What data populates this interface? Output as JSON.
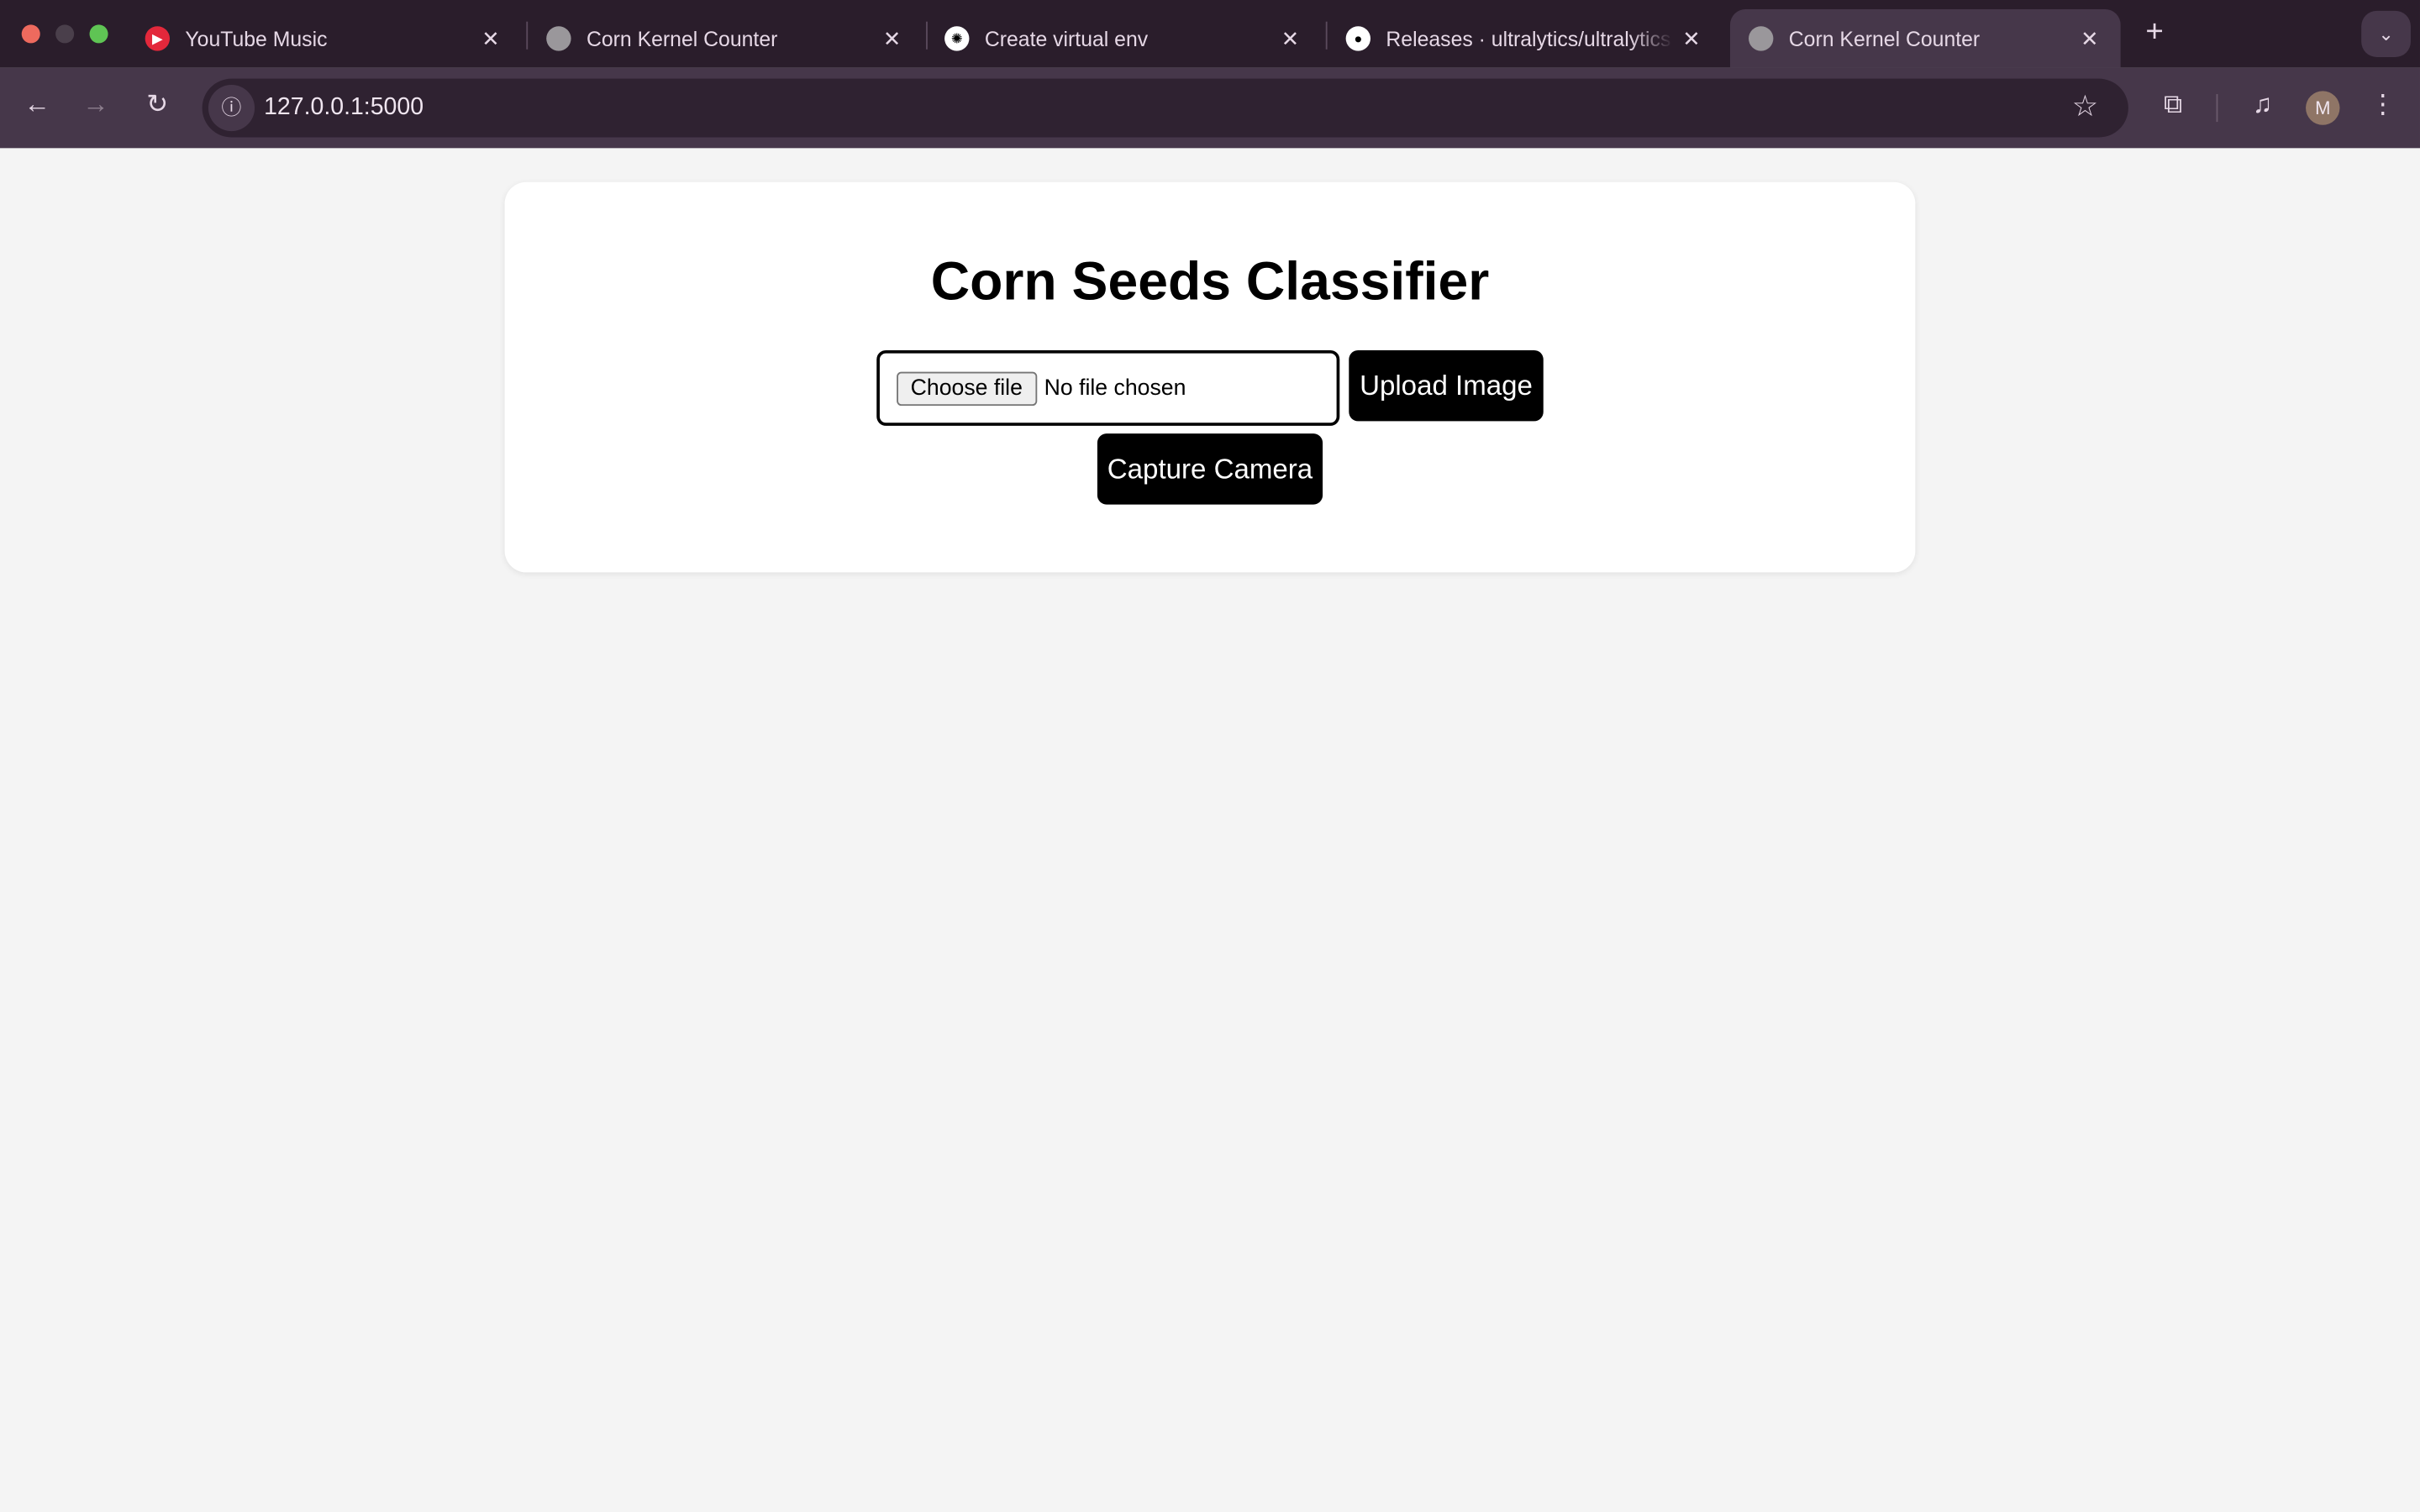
{
  "browser": {
    "tabs": [
      {
        "title": "YouTube Music",
        "icon": "youtube-music-icon"
      },
      {
        "title": "Corn Kernel Counter",
        "icon": "globe-icon"
      },
      {
        "title": "Create virtual env",
        "icon": "openai-icon"
      },
      {
        "title": "Releases · ultralytics/ultralytics",
        "icon": "github-icon"
      },
      {
        "title": "Corn Kernel Counter",
        "icon": "globe-icon",
        "active": true
      }
    ],
    "url": "127.0.0.1:5000",
    "profile_initial": "M",
    "accent": "#2a1d2b"
  },
  "page": {
    "title": "Corn Seeds Classifier",
    "file_input": {
      "button_label": "Choose file",
      "status": "No file chosen"
    },
    "upload_label": "Upload Image",
    "capture_label": "Capture Camera"
  }
}
